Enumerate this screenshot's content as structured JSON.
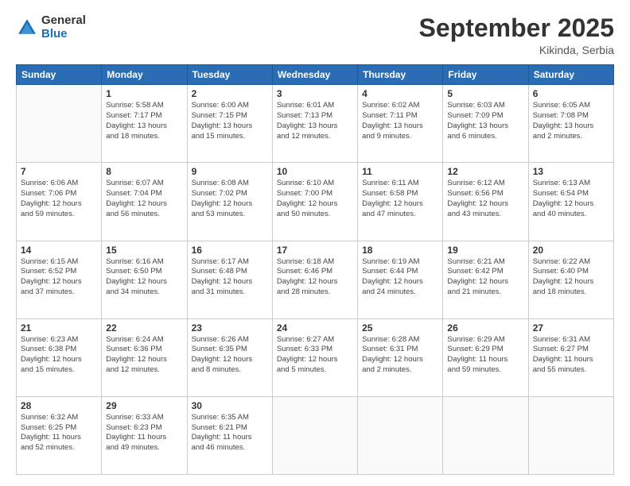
{
  "logo": {
    "general": "General",
    "blue": "Blue"
  },
  "title": "September 2025",
  "subtitle": "Kikinda, Serbia",
  "days_header": [
    "Sunday",
    "Monday",
    "Tuesday",
    "Wednesday",
    "Thursday",
    "Friday",
    "Saturday"
  ],
  "weeks": [
    [
      {
        "day": "",
        "info": ""
      },
      {
        "day": "1",
        "info": "Sunrise: 5:58 AM\nSunset: 7:17 PM\nDaylight: 13 hours\nand 18 minutes."
      },
      {
        "day": "2",
        "info": "Sunrise: 6:00 AM\nSunset: 7:15 PM\nDaylight: 13 hours\nand 15 minutes."
      },
      {
        "day": "3",
        "info": "Sunrise: 6:01 AM\nSunset: 7:13 PM\nDaylight: 13 hours\nand 12 minutes."
      },
      {
        "day": "4",
        "info": "Sunrise: 6:02 AM\nSunset: 7:11 PM\nDaylight: 13 hours\nand 9 minutes."
      },
      {
        "day": "5",
        "info": "Sunrise: 6:03 AM\nSunset: 7:09 PM\nDaylight: 13 hours\nand 6 minutes."
      },
      {
        "day": "6",
        "info": "Sunrise: 6:05 AM\nSunset: 7:08 PM\nDaylight: 13 hours\nand 2 minutes."
      }
    ],
    [
      {
        "day": "7",
        "info": "Sunrise: 6:06 AM\nSunset: 7:06 PM\nDaylight: 12 hours\nand 59 minutes."
      },
      {
        "day": "8",
        "info": "Sunrise: 6:07 AM\nSunset: 7:04 PM\nDaylight: 12 hours\nand 56 minutes."
      },
      {
        "day": "9",
        "info": "Sunrise: 6:08 AM\nSunset: 7:02 PM\nDaylight: 12 hours\nand 53 minutes."
      },
      {
        "day": "10",
        "info": "Sunrise: 6:10 AM\nSunset: 7:00 PM\nDaylight: 12 hours\nand 50 minutes."
      },
      {
        "day": "11",
        "info": "Sunrise: 6:11 AM\nSunset: 6:58 PM\nDaylight: 12 hours\nand 47 minutes."
      },
      {
        "day": "12",
        "info": "Sunrise: 6:12 AM\nSunset: 6:56 PM\nDaylight: 12 hours\nand 43 minutes."
      },
      {
        "day": "13",
        "info": "Sunrise: 6:13 AM\nSunset: 6:54 PM\nDaylight: 12 hours\nand 40 minutes."
      }
    ],
    [
      {
        "day": "14",
        "info": "Sunrise: 6:15 AM\nSunset: 6:52 PM\nDaylight: 12 hours\nand 37 minutes."
      },
      {
        "day": "15",
        "info": "Sunrise: 6:16 AM\nSunset: 6:50 PM\nDaylight: 12 hours\nand 34 minutes."
      },
      {
        "day": "16",
        "info": "Sunrise: 6:17 AM\nSunset: 6:48 PM\nDaylight: 12 hours\nand 31 minutes."
      },
      {
        "day": "17",
        "info": "Sunrise: 6:18 AM\nSunset: 6:46 PM\nDaylight: 12 hours\nand 28 minutes."
      },
      {
        "day": "18",
        "info": "Sunrise: 6:19 AM\nSunset: 6:44 PM\nDaylight: 12 hours\nand 24 minutes."
      },
      {
        "day": "19",
        "info": "Sunrise: 6:21 AM\nSunset: 6:42 PM\nDaylight: 12 hours\nand 21 minutes."
      },
      {
        "day": "20",
        "info": "Sunrise: 6:22 AM\nSunset: 6:40 PM\nDaylight: 12 hours\nand 18 minutes."
      }
    ],
    [
      {
        "day": "21",
        "info": "Sunrise: 6:23 AM\nSunset: 6:38 PM\nDaylight: 12 hours\nand 15 minutes."
      },
      {
        "day": "22",
        "info": "Sunrise: 6:24 AM\nSunset: 6:36 PM\nDaylight: 12 hours\nand 12 minutes."
      },
      {
        "day": "23",
        "info": "Sunrise: 6:26 AM\nSunset: 6:35 PM\nDaylight: 12 hours\nand 8 minutes."
      },
      {
        "day": "24",
        "info": "Sunrise: 6:27 AM\nSunset: 6:33 PM\nDaylight: 12 hours\nand 5 minutes."
      },
      {
        "day": "25",
        "info": "Sunrise: 6:28 AM\nSunset: 6:31 PM\nDaylight: 12 hours\nand 2 minutes."
      },
      {
        "day": "26",
        "info": "Sunrise: 6:29 AM\nSunset: 6:29 PM\nDaylight: 11 hours\nand 59 minutes."
      },
      {
        "day": "27",
        "info": "Sunrise: 6:31 AM\nSunset: 6:27 PM\nDaylight: 11 hours\nand 55 minutes."
      }
    ],
    [
      {
        "day": "28",
        "info": "Sunrise: 6:32 AM\nSunset: 6:25 PM\nDaylight: 11 hours\nand 52 minutes."
      },
      {
        "day": "29",
        "info": "Sunrise: 6:33 AM\nSunset: 6:23 PM\nDaylight: 11 hours\nand 49 minutes."
      },
      {
        "day": "30",
        "info": "Sunrise: 6:35 AM\nSunset: 6:21 PM\nDaylight: 11 hours\nand 46 minutes."
      },
      {
        "day": "",
        "info": ""
      },
      {
        "day": "",
        "info": ""
      },
      {
        "day": "",
        "info": ""
      },
      {
        "day": "",
        "info": ""
      }
    ]
  ]
}
